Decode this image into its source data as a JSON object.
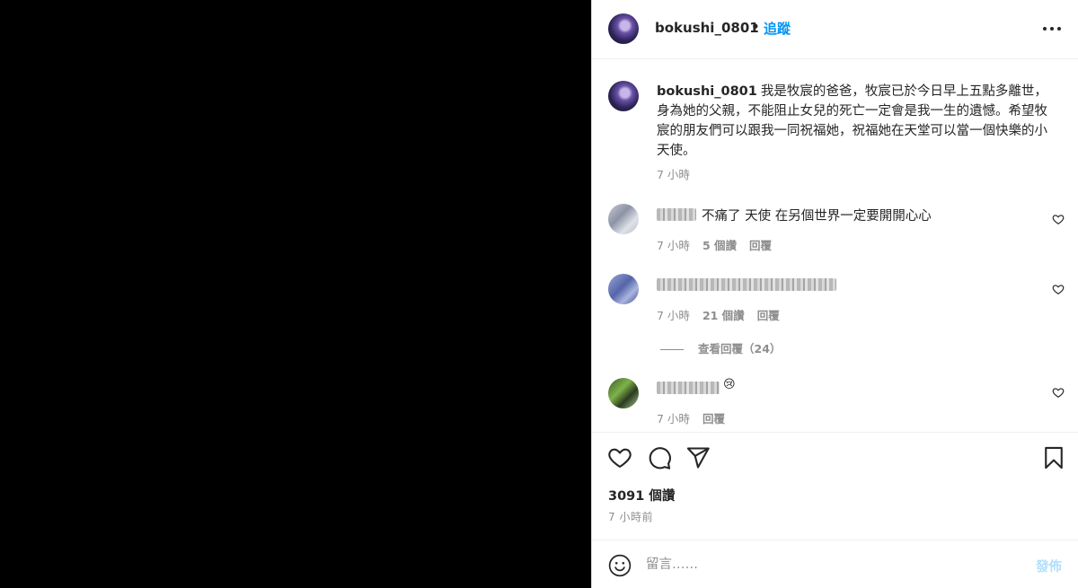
{
  "header": {
    "username": "bokushi_0801",
    "separator": "•",
    "follow_label": "追蹤",
    "more_icon": "more-horizontal-icon"
  },
  "caption": {
    "username": "bokushi_0801",
    "text": "我是牧宸的爸爸，牧宸已於今日早上五點多離世，身為她的父親，不能阻止女兒的死亡一定會是我一生的遺憾。希望牧宸的朋友們可以跟我一同祝福她，祝福她在天堂可以當一個快樂的小天使。",
    "time": "7 小時"
  },
  "comments": [
    {
      "text": "不痛了 天使 在另個世界一定要開開心心",
      "time": "7 小時",
      "likes": "5 個讚",
      "reply": "回覆"
    },
    {
      "text": "",
      "time": "7 小時",
      "likes": "21 個讚",
      "reply": "回覆",
      "view_replies": "查看回覆（24）"
    },
    {
      "text": "😢",
      "time": "7 小時",
      "reply": "回覆"
    }
  ],
  "actions": {
    "like_icon": "heart-icon",
    "comment_icon": "comment-icon",
    "share_icon": "send-icon",
    "save_icon": "bookmark-icon",
    "likes_count": "3091 個讚",
    "posted_time": "7 小時前"
  },
  "comment_box": {
    "placeholder": "留言……",
    "post_label": "發佈"
  },
  "colors": {
    "accent": "#0095f6",
    "post_disabled": "#b2dffc",
    "muted": "#8e8e8e"
  }
}
